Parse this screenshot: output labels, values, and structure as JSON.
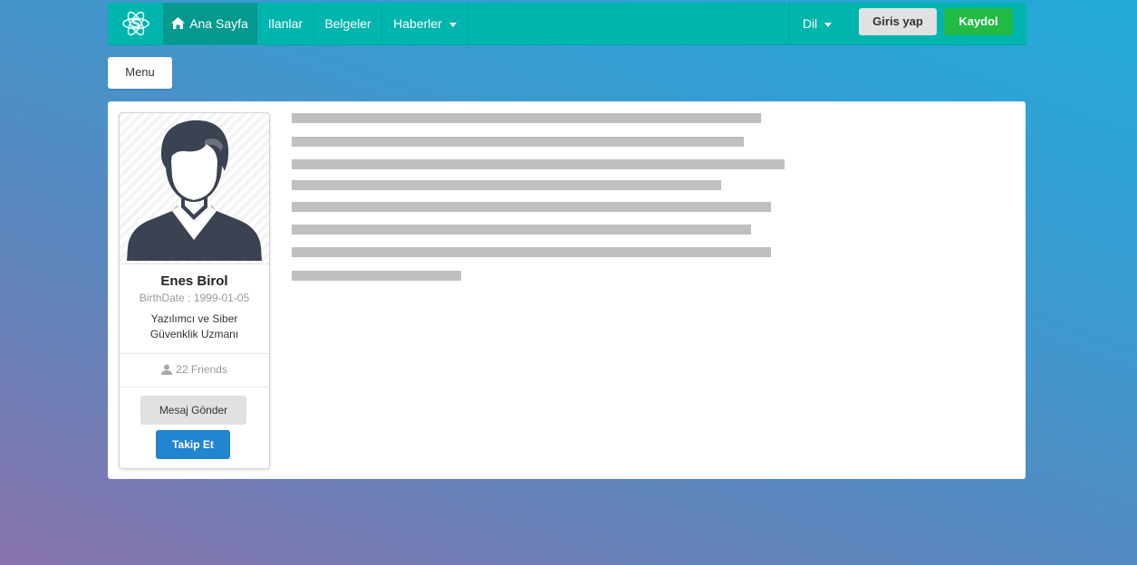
{
  "navbar": {
    "logo_icon": "atom-s-logo-icon",
    "items": [
      {
        "label": "Ana Sayfa",
        "icon": "home-icon",
        "active": true
      },
      {
        "label": "Ilanlar"
      },
      {
        "label": "Belgeler"
      },
      {
        "label": "Haberler",
        "dropdown": true
      }
    ],
    "language_label": "Dil",
    "login_label": "Giris yap",
    "signup_label": "Kaydol"
  },
  "menu_button_label": "Menu",
  "profile": {
    "name": "Enes Birol",
    "birthdate": "BirthDate : 1999-01-05",
    "description": "Yazılımcı ve Siber Güvenklik Uzmanı",
    "friends": "22 Friends",
    "message_button": "Mesaj Gönder",
    "follow_button": "Takip Et"
  },
  "content_placeholder_lines": 8,
  "colors": {
    "navbar": "#00b5ad",
    "navbar_active": "#05998f",
    "signup": "#21ba45",
    "follow": "#2185d0",
    "placeholder": "#bfbfc0"
  }
}
